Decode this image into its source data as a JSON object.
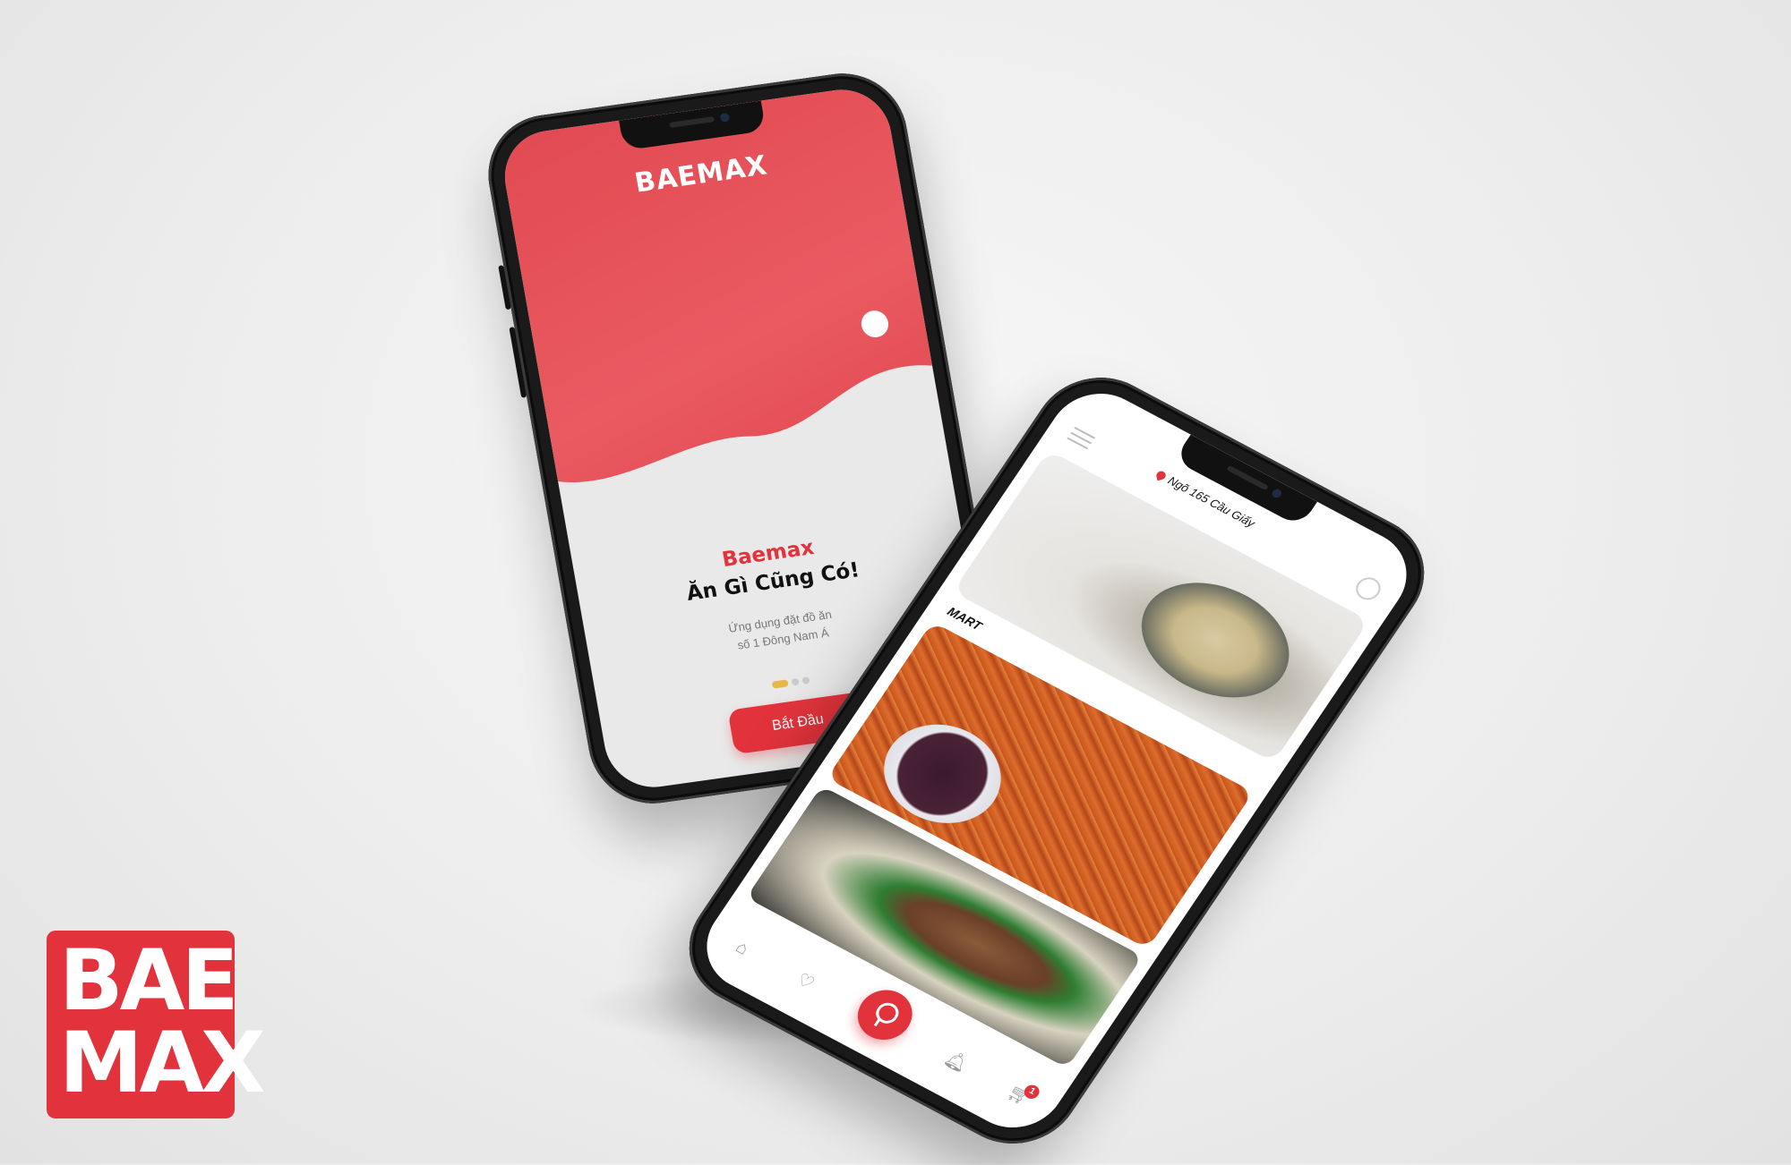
{
  "colors": {
    "brand_red": "#e2333c",
    "page_bg": "#ececec",
    "dot_active": "#e9b64a"
  },
  "onboarding": {
    "logo": "BAEMAX",
    "brand": "Baemax",
    "headline": "Ăn Gì Cũng Có!",
    "subtitle_line1": "Ứng dụng đặt đồ ăn",
    "subtitle_line2": "số 1 Đông Nam Á",
    "carousel_pages": 3,
    "carousel_active": 1,
    "start_button": "Bắt Đầu"
  },
  "home": {
    "location": "Ngõ 165 Cầu Giấy",
    "section_label": "MART",
    "cart_badge": "1",
    "icons": [
      "menu-icon",
      "location-pin-icon",
      "smile-icon",
      "home-icon",
      "heart-icon",
      "search-icon",
      "bell-icon",
      "cart-icon"
    ]
  },
  "corner_logo": {
    "line1": "BAE",
    "line2": "MAX"
  }
}
